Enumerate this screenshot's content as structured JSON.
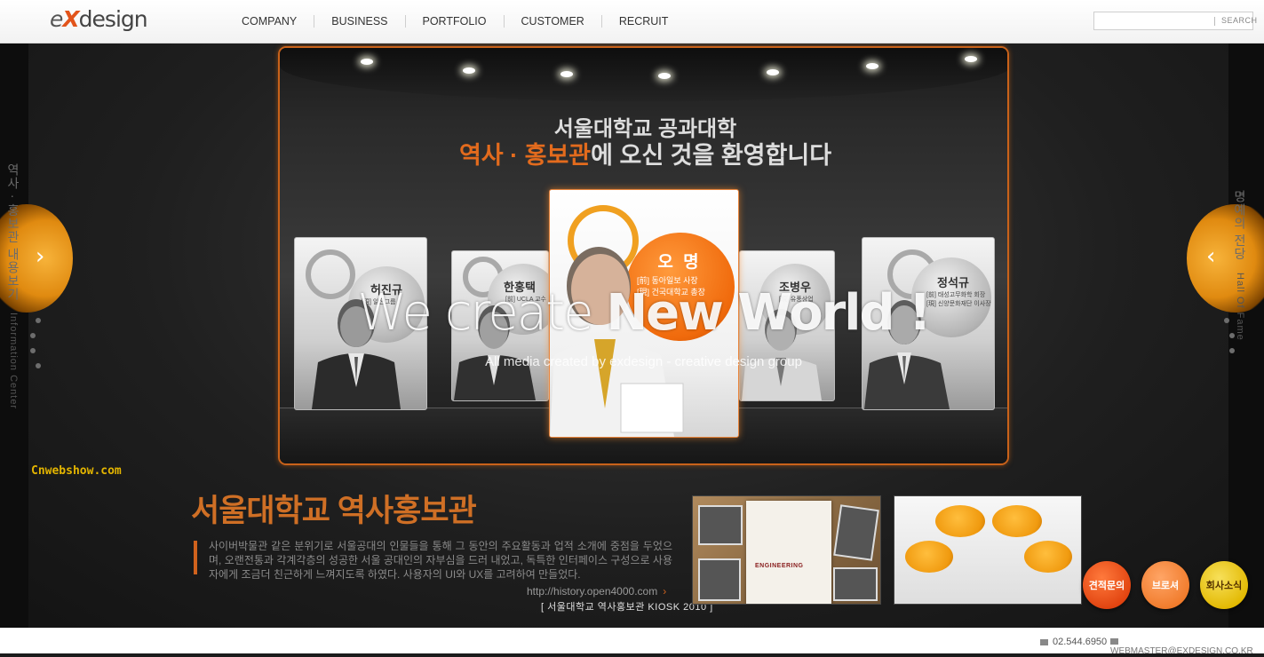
{
  "header": {
    "logo_e": "e",
    "logo_x": "X",
    "logo_rest": "design",
    "nav": [
      "COMPANY",
      "BUSINESS",
      "PORTFOLIO",
      "CUSTOMER",
      "RECRUIT"
    ],
    "search_placeholder": "",
    "search_label": "SEARCH"
  },
  "side": {
    "left_kr": "역사 · 홍보관 내용보기",
    "left_en": "Information Center",
    "right_kr": "명예의 전당",
    "right_en": "Hall Of Fame",
    "prev_arrow": "‹",
    "next_arrow": "‹"
  },
  "showcase": {
    "welcome_line1": "서울대학교 공과대학",
    "welcome_highlight": "역사 · 홍보관",
    "welcome_rest": "에 오신 것을 환영합니다",
    "cards": [
      {
        "name": "허진규",
        "desc": "[現] 일진그룹"
      },
      {
        "name": "한홍택",
        "desc": "[前] UCLA 교수"
      },
      {
        "name": "오 명",
        "desc1": "[前] 동아일보 사장",
        "desc2": "[現] 건국대학교 총장"
      },
      {
        "name": "조병우",
        "desc": "[現] 유풍상업"
      },
      {
        "name": "정석규",
        "desc1": "[前] 태성고무화학 회장",
        "desc2": "[現] 신양문화재단 이사장"
      }
    ]
  },
  "hero": {
    "line1_light": "We create ",
    "line1_bold": "New World !",
    "line2": "All media created by exdesign - creative design group"
  },
  "watermark": "Cnwebshow.com",
  "project": {
    "title": "서울대학교 역사홍보관",
    "description": "사이버박물관 같은 분위기로 서울공대의 인물들을 통해 그 동안의 주요활동과 업적 소개에 중점을 두었으며, 오랜전통과 각계각층의 성공한 서울 공대인의 자부심을 드러 내었고, 독특한 인터페이스 구성으로 사용자에게 조금더 친근하게 느껴지도록 하였다. 사용자의 UI와 UX를 고려하여 만들었다.",
    "url": "http://history.open4000.com",
    "caption": "[ 서울대학교 역사홍보관 KIOSK 2010 ]",
    "thumb_text": "ENGINEERING"
  },
  "buttons": [
    "견적문의",
    "브로셔",
    "회사소식"
  ],
  "footer": {
    "phone": "02.544.6950",
    "email": "WEBMASTER@EXDESIGN.CO.KR"
  },
  "colors": {
    "accent": "#e36b1d",
    "frame": "#c9621a",
    "watermark": "#e4b500"
  }
}
